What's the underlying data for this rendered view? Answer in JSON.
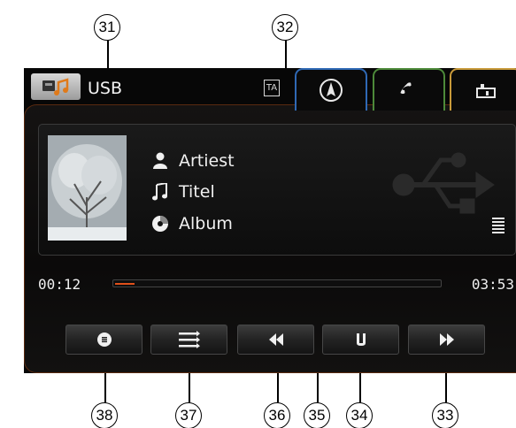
{
  "header": {
    "source_label": "USB",
    "ta_label": "TA",
    "tabs": [
      {
        "name": "navigation",
        "icon": "compass-icon",
        "color": "#2f69b5"
      },
      {
        "name": "phone",
        "icon": "phone-icon",
        "color": "#4d8a3a"
      },
      {
        "name": "media",
        "icon": "media-source-icon",
        "color": "#c89a3a"
      }
    ]
  },
  "track": {
    "artist": "Artiest",
    "title": "Titel",
    "album": "Album",
    "elapsed": "00:12",
    "total": "03:53",
    "progress": 0.06
  },
  "controls": [
    {
      "name": "source-menu-button",
      "icon": "disc-menu-icon"
    },
    {
      "name": "playlist-button",
      "icon": "list-icon"
    },
    {
      "name": "previous-button",
      "icon": "skip-back-icon"
    },
    {
      "name": "pause-button",
      "icon": "pause-icon"
    },
    {
      "name": "next-button",
      "icon": "skip-forward-icon"
    }
  ],
  "callouts": {
    "c31": "31",
    "c32": "32",
    "c33": "33",
    "c34": "34",
    "c35": "35",
    "c36": "36",
    "c37": "37",
    "c38": "38"
  },
  "colors": {
    "accent_progress": "#e0501a",
    "frame": "#5a2a10",
    "nav_tab": "#2f69b5",
    "phone_tab": "#4d8a3a",
    "media_tab": "#c89a3a"
  }
}
